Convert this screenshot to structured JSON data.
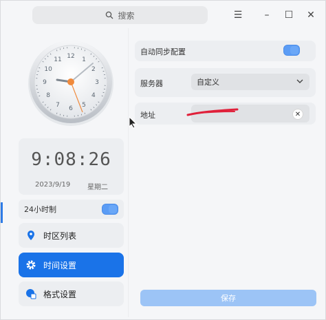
{
  "search": {
    "placeholder": "搜索"
  },
  "titlebar": {
    "menu_icon": "menu-icon",
    "minimize_icon": "minimize-icon",
    "maximize_icon": "maximize-icon",
    "close_icon": "close-icon"
  },
  "clock": {
    "time": "9:08:26",
    "date": "2023/9/19",
    "weekday": "星期二",
    "numerals": [
      "12",
      "1",
      "2",
      "3",
      "4",
      "5",
      "6",
      "7",
      "8",
      "9",
      "10",
      "11"
    ]
  },
  "toggle_24h": {
    "label": "24小时制",
    "on": true
  },
  "nav": [
    {
      "label": "时区列表",
      "icon": "location-pin-icon",
      "active": false
    },
    {
      "label": "时间设置",
      "icon": "gear-icon",
      "active": true
    },
    {
      "label": "格式设置",
      "icon": "calendar-format-icon",
      "active": false
    }
  ],
  "settings": {
    "auto_sync": {
      "label": "自动同步配置",
      "on": true
    },
    "server": {
      "label": "服务器",
      "value": "自定义"
    },
    "address": {
      "label": "地址",
      "value": ""
    },
    "save_label": "保存"
  },
  "colors": {
    "accent": "#1a73e8",
    "save_disabled": "#9cc4f6",
    "redline": "#e0203a"
  }
}
